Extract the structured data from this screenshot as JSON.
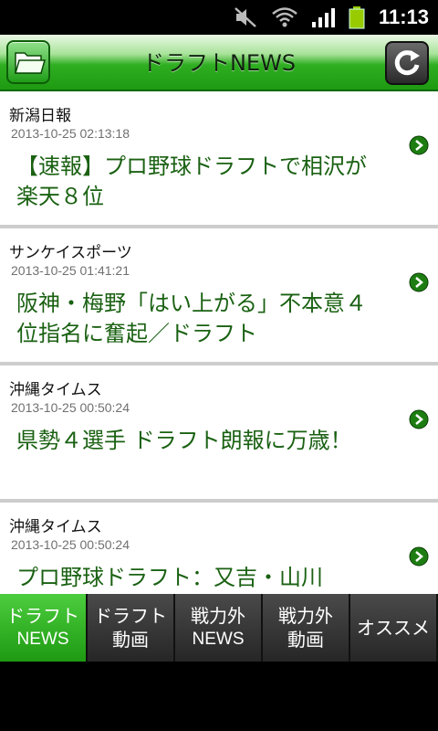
{
  "status_bar": {
    "time": "11:13",
    "icons": [
      "mute-icon",
      "wifi-icon",
      "signal-icon",
      "battery-icon"
    ]
  },
  "header": {
    "title": "ドラフトNEWS",
    "folder_icon": "folder-icon",
    "refresh_icon": "refresh-icon",
    "accent_color": "#2fae21"
  },
  "news": [
    {
      "source": "新潟日報",
      "date": "2013-10-25 02:13:18",
      "headline": "【速報】プロ野球ドラフトで相沢が楽天８位"
    },
    {
      "source": "サンケイスポーツ",
      "date": "2013-10-25 01:41:21",
      "headline": "阪神・梅野「はい上がる」不本意４位指名に奮起／ドラフト"
    },
    {
      "source": "沖縄タイムス",
      "date": "2013-10-25 00:50:24",
      "headline": "県勢４選手 ドラフト朗報に万歳！"
    },
    {
      "source": "沖縄タイムス",
      "date": "2013-10-25 00:50:24",
      "headline": "プロ野球ドラフト：又吉・山川"
    }
  ],
  "tabs": [
    {
      "line1": "ドラフト",
      "line2": "NEWS",
      "active": true
    },
    {
      "line1": "ドラフト",
      "line2": "動画",
      "active": false
    },
    {
      "line1": "戦力外",
      "line2": "NEWS",
      "active": false
    },
    {
      "line1": "戦力外",
      "line2": "動画",
      "active": false
    },
    {
      "line1": "オススメ",
      "line2": "",
      "active": false
    }
  ]
}
